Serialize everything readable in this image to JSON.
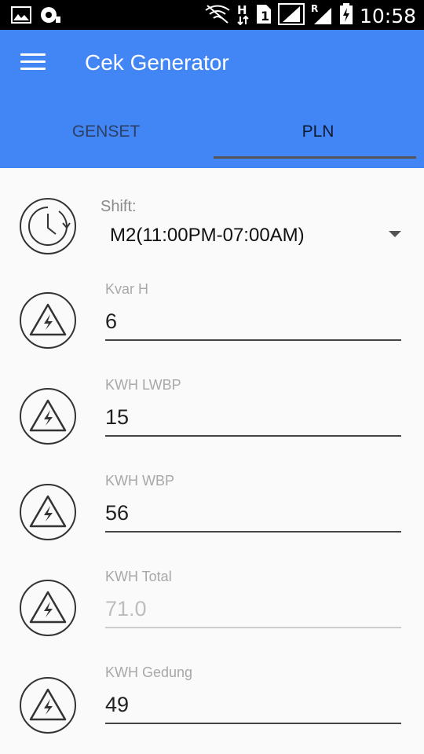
{
  "status_bar": {
    "time": "10:58",
    "icons": [
      "image-icon",
      "photo-toggle-icon",
      "no-wifi-icon",
      "h-network-icon",
      "sim-1-icon",
      "signal-icon",
      "roaming-r-icon",
      "signal-icon",
      "battery-charging-icon"
    ]
  },
  "app_bar": {
    "title": "Cek Generator",
    "menu_icon": "hamburger-menu-icon",
    "color": "#4285f4"
  },
  "tabs": [
    {
      "label": "GENSET",
      "active": false
    },
    {
      "label": "PLN",
      "active": true
    }
  ],
  "form": {
    "shift": {
      "label": "Shift:",
      "value": "M2(11:00PM-07:00AM)",
      "icon": "clock-icon"
    },
    "fields": [
      {
        "label": "Kvar H",
        "value": "6",
        "icon": "high-voltage-icon",
        "enabled": true
      },
      {
        "label": "KWH LWBP",
        "value": "15",
        "icon": "high-voltage-icon",
        "enabled": true
      },
      {
        "label": "KWH WBP",
        "value": "56",
        "icon": "high-voltage-icon",
        "enabled": true
      },
      {
        "label": "KWH Total",
        "value": "71.0",
        "icon": "high-voltage-icon",
        "enabled": false
      },
      {
        "label": "KWH Gedung",
        "value": "49",
        "icon": "high-voltage-icon",
        "enabled": true
      }
    ]
  }
}
